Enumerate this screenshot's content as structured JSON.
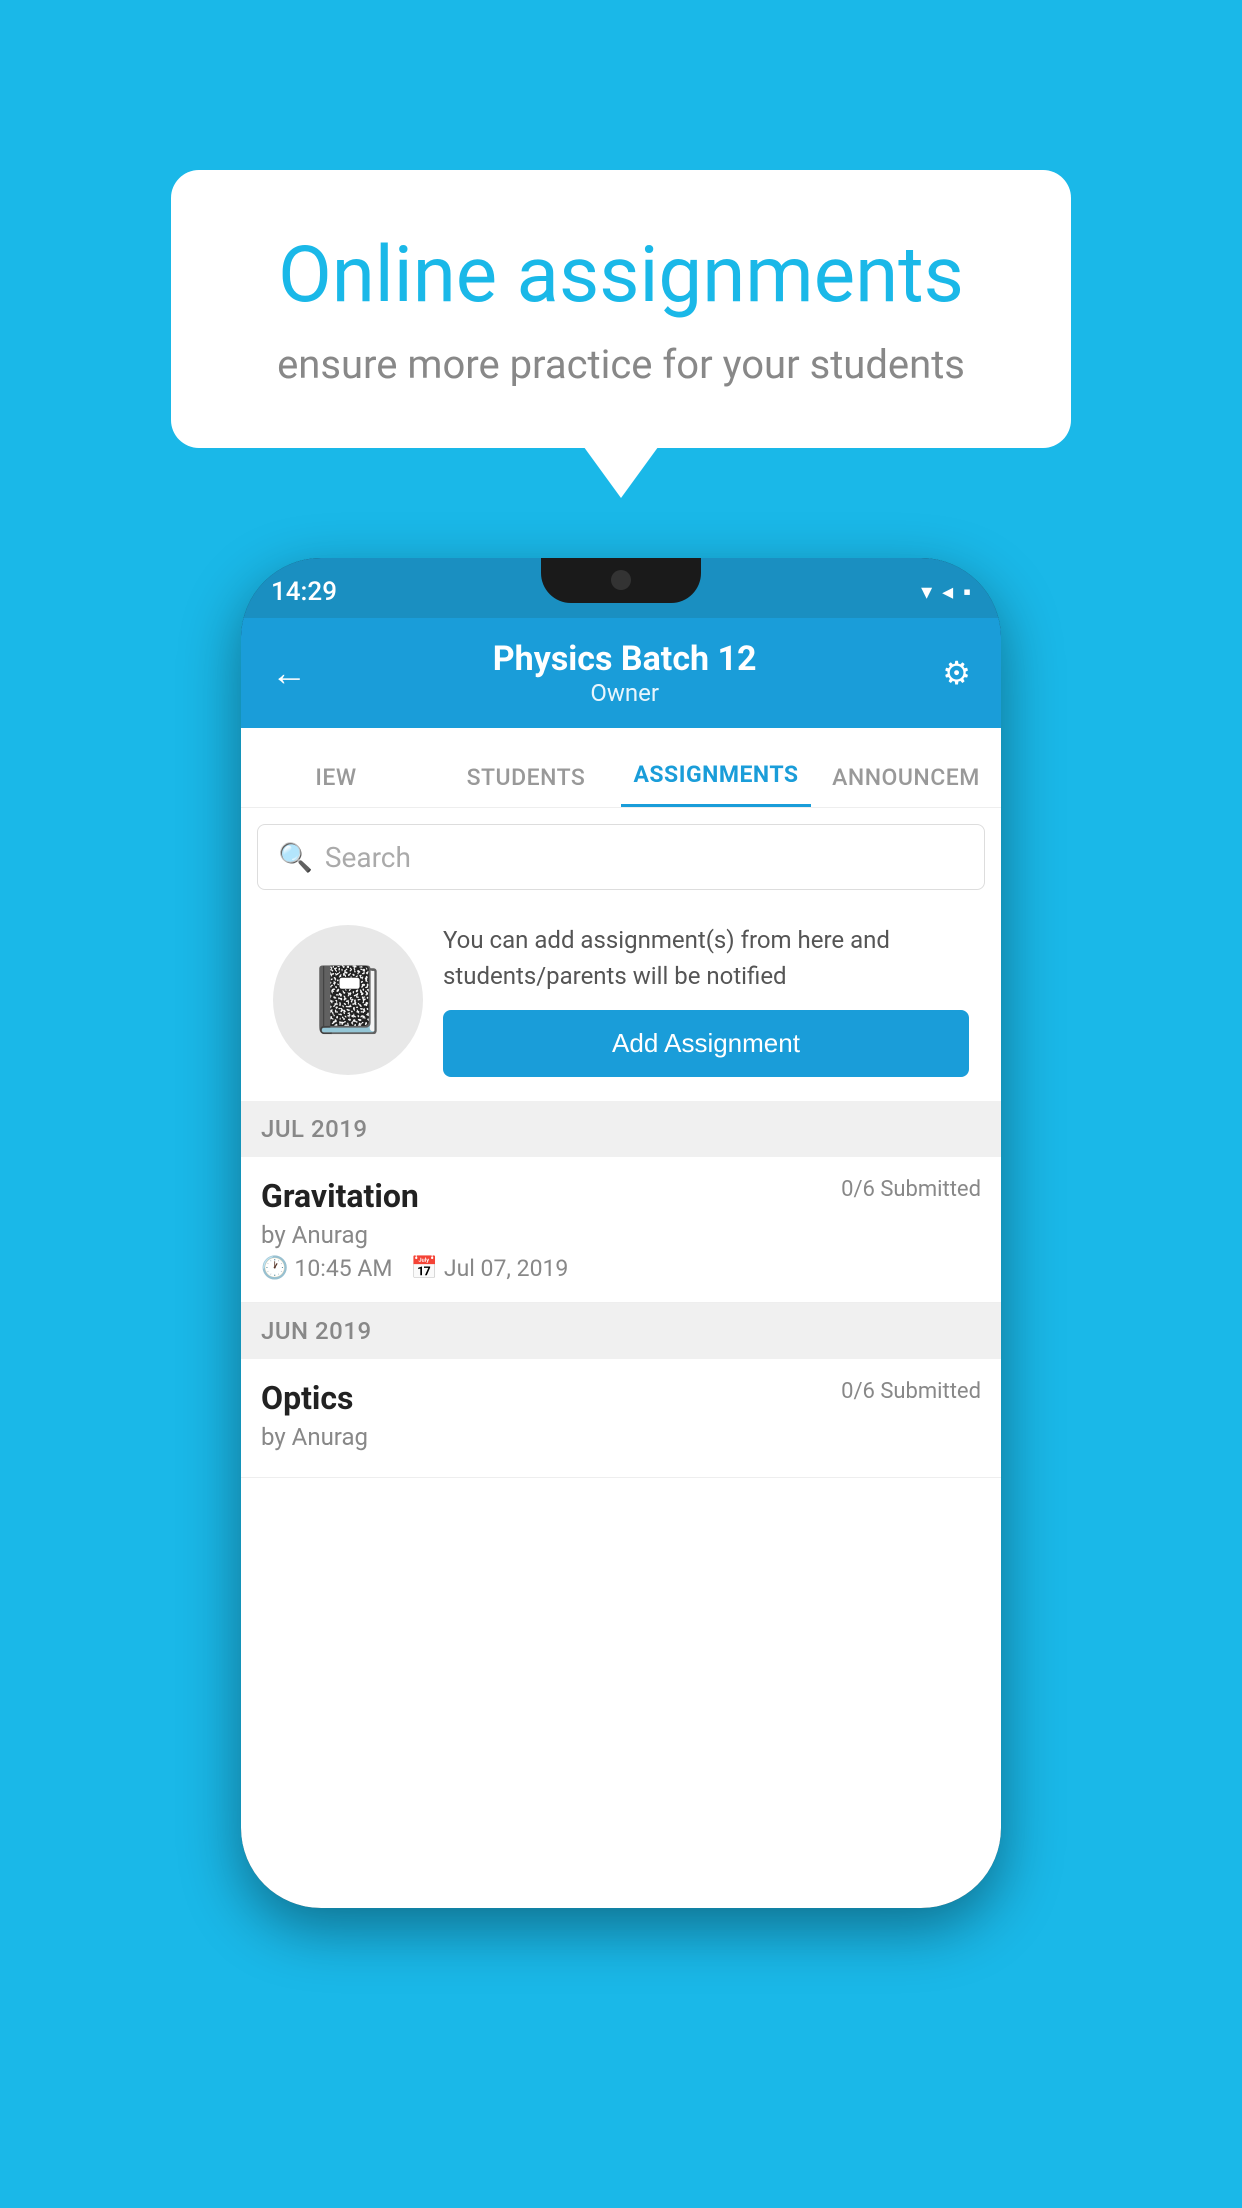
{
  "bubble": {
    "title": "Online assignments",
    "subtitle": "ensure more practice for your students"
  },
  "status_bar": {
    "time": "14:29"
  },
  "app_header": {
    "title": "Physics Batch 12",
    "subtitle": "Owner"
  },
  "tabs": [
    {
      "label": "IEW",
      "active": false
    },
    {
      "label": "STUDENTS",
      "active": false
    },
    {
      "label": "ASSIGNMENTS",
      "active": true
    },
    {
      "label": "ANNOUNCEM",
      "active": false
    }
  ],
  "search": {
    "placeholder": "Search"
  },
  "promo": {
    "description": "You can add assignment(s) from here and students/parents will be notified",
    "button_label": "Add Assignment"
  },
  "month_sections": [
    {
      "label": "JUL 2019",
      "assignments": [
        {
          "name": "Gravitation",
          "submitted": "0/6 Submitted",
          "author": "by Anurag",
          "time": "10:45 AM",
          "date": "Jul 07, 2019"
        }
      ]
    },
    {
      "label": "JUN 2019",
      "assignments": [
        {
          "name": "Optics",
          "submitted": "0/6 Submitted",
          "author": "by Anurag",
          "time": "",
          "date": ""
        }
      ]
    }
  ]
}
